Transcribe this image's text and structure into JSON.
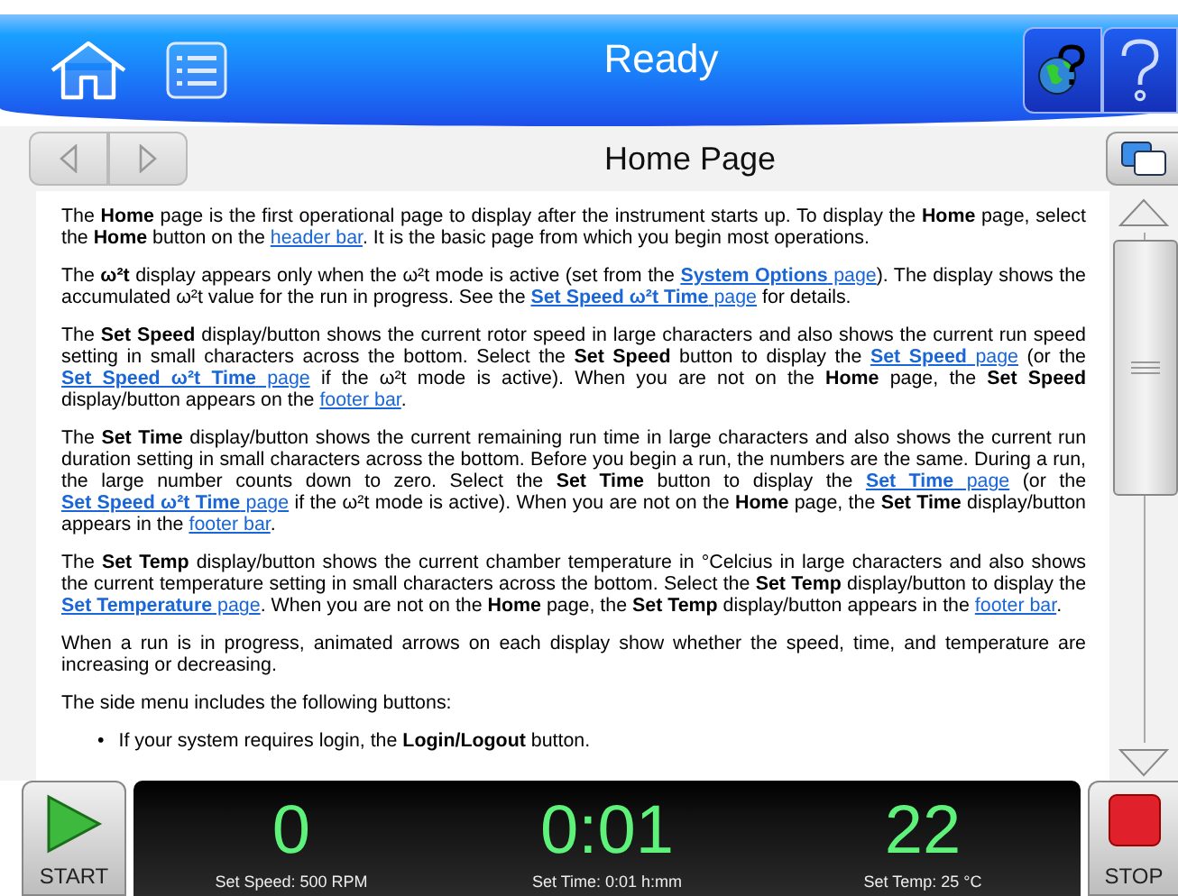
{
  "header": {
    "title": "Ready"
  },
  "help": {
    "title": "Home Page",
    "paragraphs": [
      [
        {
          "text": "The **Home** page is the first operational page to display after the instrument starts up. To display the **Home** page, select the **Home** button on the "
        },
        {
          "link": "header bar"
        },
        {
          "text": ". It is the basic page from which you begin most operations."
        }
      ],
      [
        {
          "text": "The **ω²t** display appears only when the ω²t mode is active (set from the "
        },
        {
          "link": "**System Options** page"
        },
        {
          "text": "). The display shows the accumulated ω²t value for the run in progress. See the "
        },
        {
          "link": "**Set Speed ω²t Time** page"
        },
        {
          "text": " for details."
        }
      ],
      [
        {
          "text": "The **Set Speed** display/button shows the current rotor speed in large characters and also shows the current run speed setting in small characters across the bottom. Select the **Set Speed** button to display the "
        },
        {
          "link": "**Set Speed** page"
        },
        {
          "text": " (or the "
        },
        {
          "link": "**Set Speed ω²t Time** page"
        },
        {
          "text": " if the ω²t mode is active). When you are not on the **Home** page, the **Set Speed** display/button appears on the "
        },
        {
          "link": "footer bar"
        },
        {
          "text": "."
        }
      ],
      [
        {
          "text": "The **Set Time** display/button shows the current remaining run time in large characters and also shows the current run duration setting in small characters across the bottom. Before you begin a run, the numbers are the same. During a run, the large number counts down to zero. Select the **Set Time** button to display the "
        },
        {
          "link": "**Set Time** page"
        },
        {
          "text": " (or the "
        },
        {
          "link": "**Set Speed ω²t Time** page"
        },
        {
          "text": " if the ω²t mode is active). When you are not on the **Home** page, the **Set Time** display/button appears in the "
        },
        {
          "link": "footer bar"
        },
        {
          "text": "."
        }
      ],
      [
        {
          "text": "The **Set Temp** display/button shows the current chamber temperature in °Celcius in large characters and also shows the current temperature setting in small characters across the bottom. Select the **Set Temp** display/button to display the "
        },
        {
          "link": "**Set Temperature** page"
        },
        {
          "text": ". When you are not on the **Home** page, the **Set Temp** display/button appears in the "
        },
        {
          "link": "footer bar"
        },
        {
          "text": "."
        }
      ],
      [
        {
          "text": "When a run is in progress, animated arrows on each display show whether the speed, time, and temperature are increasing or decreasing."
        }
      ],
      [
        {
          "text": "The side menu includes the following buttons:"
        }
      ]
    ],
    "bullets": [
      {
        "marker": "•",
        "text": "If your system requires login, the **Login/Logout** button."
      }
    ]
  },
  "footer": {
    "start": "START",
    "stop": "STOP",
    "readouts": [
      {
        "value": "0",
        "caption": "Set Speed: 500 RPM"
      },
      {
        "value": "0:01",
        "caption": "Set Time: 0:01 h:mm"
      },
      {
        "value": "22",
        "caption": "Set Temp: 25 °C"
      }
    ]
  }
}
